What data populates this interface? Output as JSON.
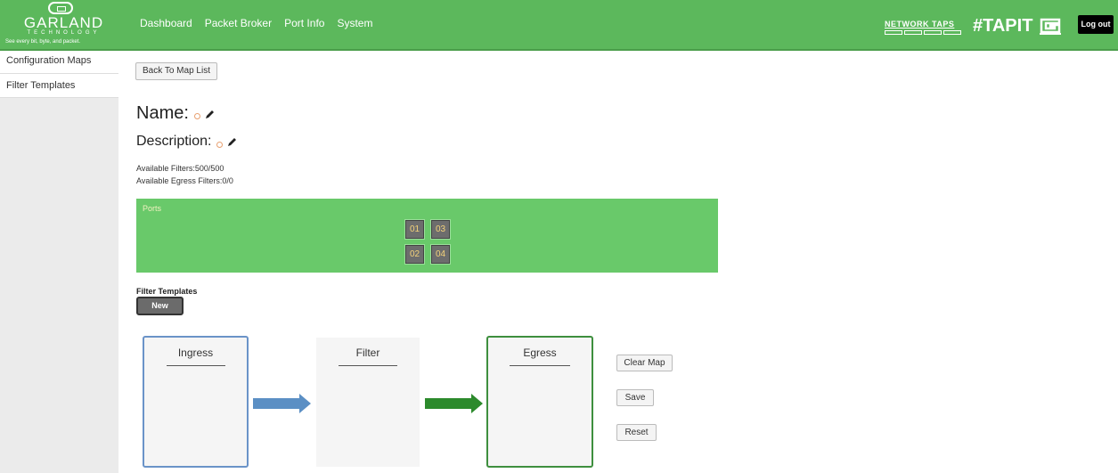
{
  "header": {
    "logo": {
      "name": "GARLAND",
      "subtitle": "TECHNOLOGY",
      "tagline": "See every bit, byte, and packet."
    },
    "nav": [
      "Dashboard",
      "Packet Broker",
      "Port Info",
      "System"
    ],
    "network_taps": "NETWORK TAPS",
    "tapit": "#TAPIT",
    "logout": "Log out",
    "colors": {
      "bar": "#5cb85c"
    }
  },
  "sidebar": {
    "items": [
      {
        "label": "Configuration Maps"
      },
      {
        "label": "Filter Templates"
      }
    ]
  },
  "main": {
    "back_button": "Back To Map List",
    "name_label": "Name:",
    "description_label": "Description:",
    "available_filters": "Available Filters:500/500",
    "available_egress": "Available Egress Filters:0/0",
    "ports": {
      "label": "Ports",
      "items": [
        "01",
        "03",
        "02",
        "04"
      ]
    },
    "filter_templates_label": "Filter Templates",
    "new_button": "New",
    "flow": {
      "ingress": "Ingress",
      "filter": "Filter",
      "egress": "Egress"
    },
    "actions": {
      "clear": "Clear Map",
      "save": "Save",
      "reset": "Reset"
    }
  }
}
